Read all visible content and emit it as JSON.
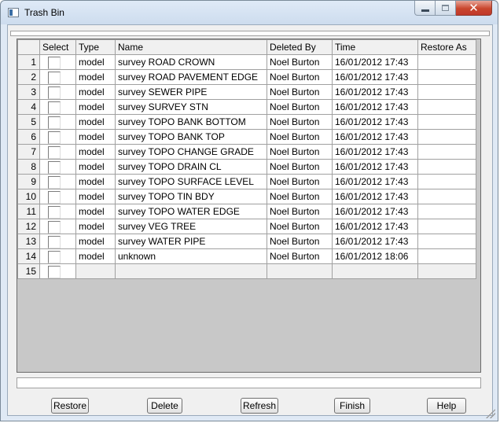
{
  "window": {
    "title": "Trash Bin",
    "icon": "window-app-icon"
  },
  "controls": {
    "minimize": "minimize-icon",
    "maximize": "maximize-icon",
    "close": "✕"
  },
  "table": {
    "columns": [
      "",
      "Select",
      "Type",
      "Name",
      "Deleted By",
      "Time",
      "Restore As"
    ],
    "rows": [
      {
        "num": "1",
        "type": "model",
        "name": "survey ROAD CROWN",
        "deleted_by": "Noel Burton",
        "time": "16/01/2012 17:43",
        "restore_as": ""
      },
      {
        "num": "2",
        "type": "model",
        "name": "survey ROAD PAVEMENT EDGE",
        "deleted_by": "Noel Burton",
        "time": "16/01/2012 17:43",
        "restore_as": ""
      },
      {
        "num": "3",
        "type": "model",
        "name": "survey SEWER PIPE",
        "deleted_by": "Noel Burton",
        "time": "16/01/2012 17:43",
        "restore_as": ""
      },
      {
        "num": "4",
        "type": "model",
        "name": "survey SURVEY STN",
        "deleted_by": "Noel Burton",
        "time": "16/01/2012 17:43",
        "restore_as": ""
      },
      {
        "num": "5",
        "type": "model",
        "name": "survey TOPO BANK BOTTOM",
        "deleted_by": "Noel Burton",
        "time": "16/01/2012 17:43",
        "restore_as": ""
      },
      {
        "num": "6",
        "type": "model",
        "name": "survey TOPO BANK TOP",
        "deleted_by": "Noel Burton",
        "time": "16/01/2012 17:43",
        "restore_as": ""
      },
      {
        "num": "7",
        "type": "model",
        "name": "survey TOPO CHANGE GRADE",
        "deleted_by": "Noel Burton",
        "time": "16/01/2012 17:43",
        "restore_as": ""
      },
      {
        "num": "8",
        "type": "model",
        "name": "survey TOPO DRAIN CL",
        "deleted_by": "Noel Burton",
        "time": "16/01/2012 17:43",
        "restore_as": ""
      },
      {
        "num": "9",
        "type": "model",
        "name": "survey TOPO SURFACE LEVEL",
        "deleted_by": "Noel Burton",
        "time": "16/01/2012 17:43",
        "restore_as": ""
      },
      {
        "num": "10",
        "type": "model",
        "name": "survey TOPO TIN BDY",
        "deleted_by": "Noel Burton",
        "time": "16/01/2012 17:43",
        "restore_as": ""
      },
      {
        "num": "11",
        "type": "model",
        "name": "survey TOPO WATER EDGE",
        "deleted_by": "Noel Burton",
        "time": "16/01/2012 17:43",
        "restore_as": ""
      },
      {
        "num": "12",
        "type": "model",
        "name": "survey VEG TREE",
        "deleted_by": "Noel Burton",
        "time": "16/01/2012 17:43",
        "restore_as": ""
      },
      {
        "num": "13",
        "type": "model",
        "name": "survey WATER PIPE",
        "deleted_by": "Noel Burton",
        "time": "16/01/2012 17:43",
        "restore_as": ""
      },
      {
        "num": "14",
        "type": "model",
        "name": "unknown",
        "deleted_by": "Noel Burton",
        "time": "16/01/2012 18:06",
        "restore_as": ""
      },
      {
        "num": "15",
        "type": "",
        "name": "",
        "deleted_by": "",
        "time": "",
        "restore_as": ""
      }
    ]
  },
  "buttons": {
    "restore": "Restore",
    "delete": "Delete",
    "refresh": "Refresh",
    "finish": "Finish",
    "help": "Help"
  },
  "colors": {
    "close_button": "#c9462d",
    "titlebar": "#dfeaf7"
  }
}
